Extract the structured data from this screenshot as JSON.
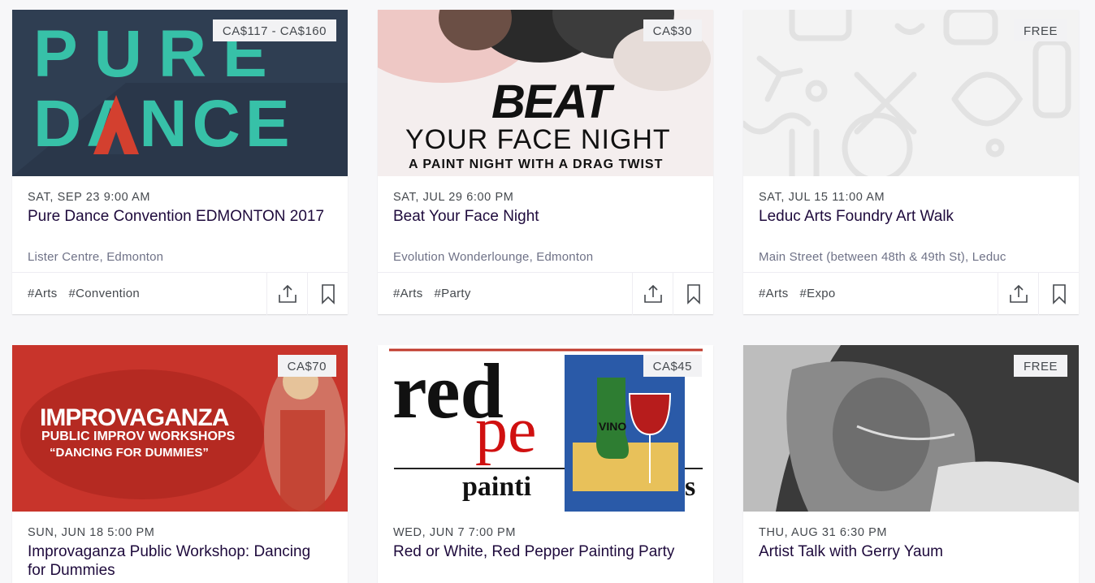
{
  "events": [
    {
      "price": "CA$117 - CA$160",
      "date": "SAT, SEP 23 9:00 AM",
      "title": "Pure Dance Convention EDMONTON 2017",
      "venue": "Lister Centre, Edmonton",
      "tags": [
        "#Arts",
        "#Convention"
      ],
      "image_text": [
        "PURE",
        "DANCE"
      ]
    },
    {
      "price": "CA$30",
      "date": "SAT, JUL 29 6:00 PM",
      "title": "Beat Your Face Night",
      "venue": "Evolution Wonderlounge, Edmonton",
      "tags": [
        "#Arts",
        "#Party"
      ],
      "image_text": [
        "BEAT",
        "YOUR FACE NIGHT",
        "A PAINT NIGHT WITH A DRAG TWIST"
      ]
    },
    {
      "price": "FREE",
      "date": "SAT, JUL 15 11:00 AM",
      "title": "Leduc Arts Foundry Art Walk",
      "venue": "Main Street (between 48th & 49th St), Leduc",
      "tags": [
        "#Arts",
        "#Expo"
      ]
    },
    {
      "price": "CA$70",
      "date": "SUN, JUN 18 5:00 PM",
      "title": "Improvaganza Public Workshop: Dancing for Dummies",
      "image_text": [
        "IMPROVAGANZA",
        "PUBLIC IMPROV WORKSHOPS",
        "“DANCING FOR DUMMIES”"
      ]
    },
    {
      "price": "CA$45",
      "date": "WED, JUN 7 7:00 PM",
      "title": "Red or White, Red Pepper Painting Party",
      "image_text": [
        "red",
        "pe",
        "painti",
        "s",
        "VINO"
      ]
    },
    {
      "price": "FREE",
      "date": "THU, AUG 31 6:30 PM",
      "title": "Artist Talk with Gerry Yaum"
    }
  ],
  "colors": {
    "teal": "#37c1a8",
    "navy": "#2f3e52",
    "red": "#c8342b"
  },
  "icons": {
    "share": "share-icon",
    "bookmark": "bookmark-icon"
  }
}
